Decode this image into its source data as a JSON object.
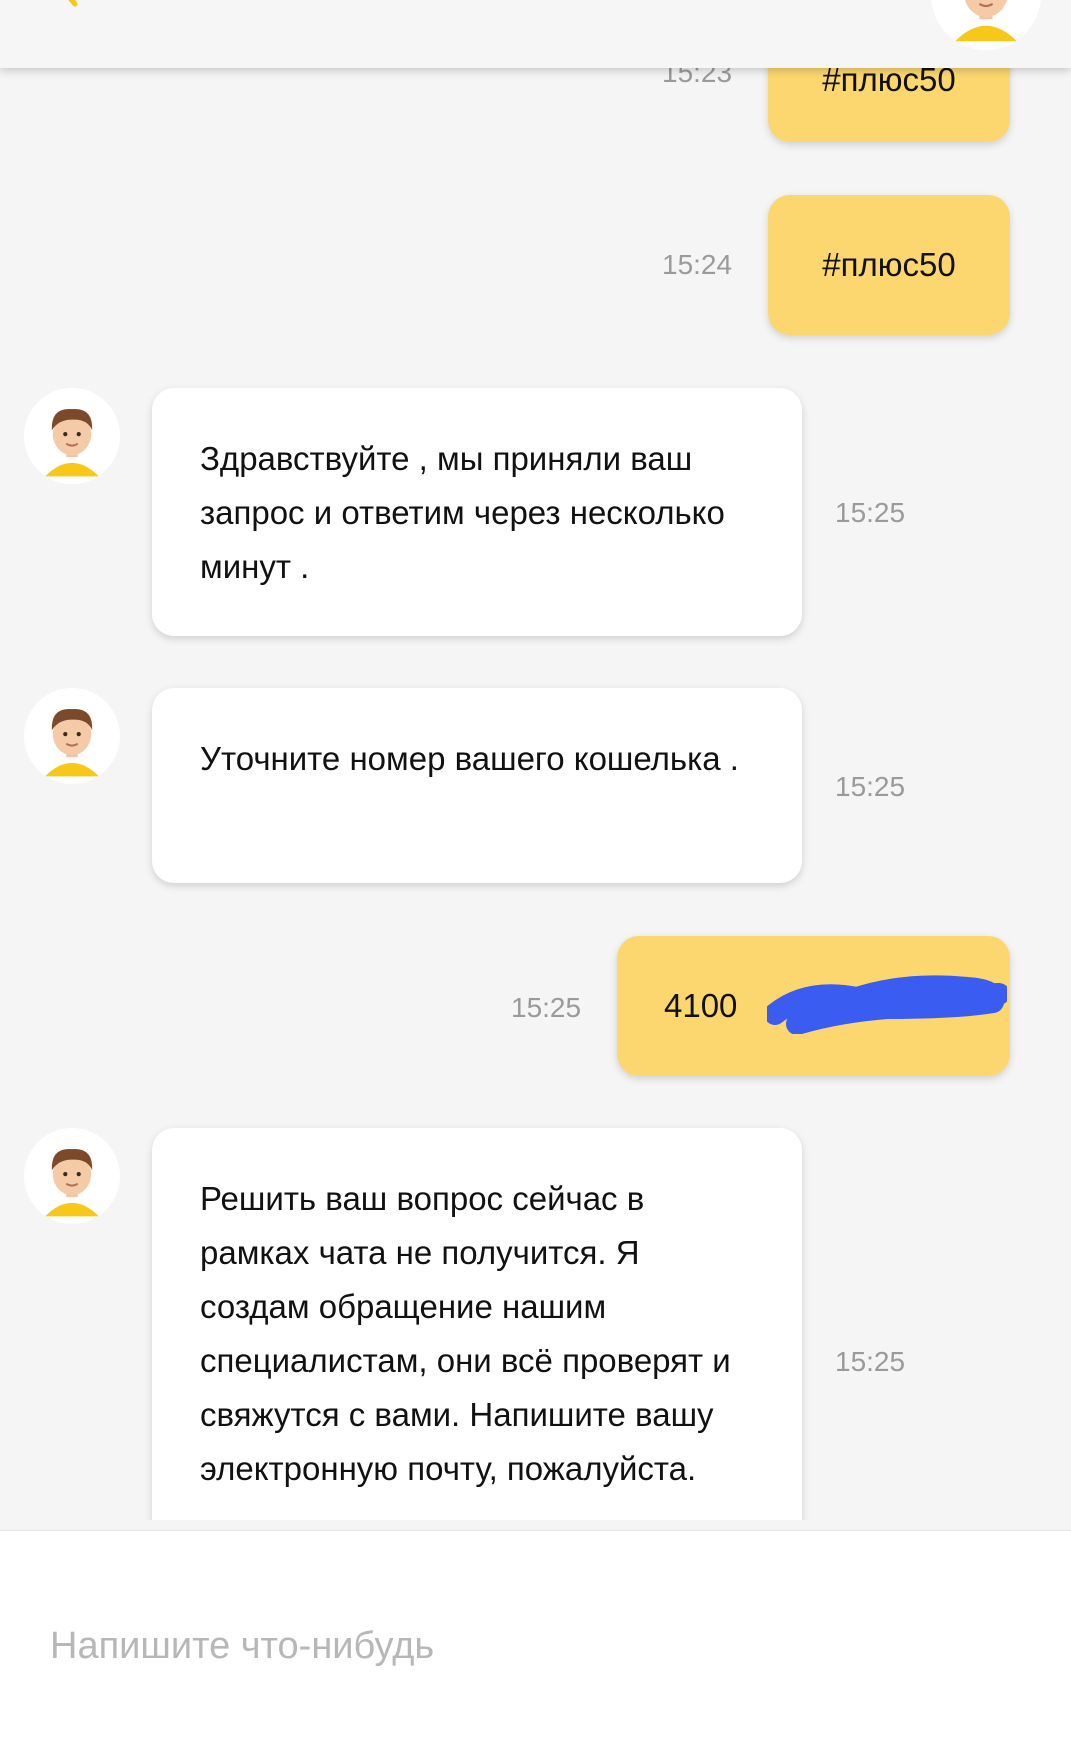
{
  "messages": [
    {
      "text": "#плюс50",
      "time": "15:23"
    },
    {
      "text": "#плюс50",
      "time": "15:24"
    },
    {
      "text": "Здравствуйте , мы приняли ваш запрос и ответим через несколько минут .",
      "time": "15:25"
    },
    {
      "text": "Уточните номер вашего кошелька .",
      "time": "15:25"
    },
    {
      "text": "4100",
      "time": "15:25"
    },
    {
      "text": "Решить ваш вопрос сейчас в рамках чата не получится. Я создам обращение нашим специалистам, они всё проверят и свяжутся с  вами. Напишите вашу электронную почту, пожалуйста.",
      "time": "15:25"
    }
  ],
  "composer": {
    "placeholder": "Напишите что-нибудь"
  },
  "colors": {
    "outgoing_bubble": "#fcd770",
    "incoming_bubble": "#ffffff",
    "background": "#f5f5f5",
    "redaction": "#3a5cf0",
    "accent": "#f7c71a"
  },
  "icons": {
    "back": "back-arrow-icon",
    "avatar": "support-agent-avatar-icon"
  }
}
